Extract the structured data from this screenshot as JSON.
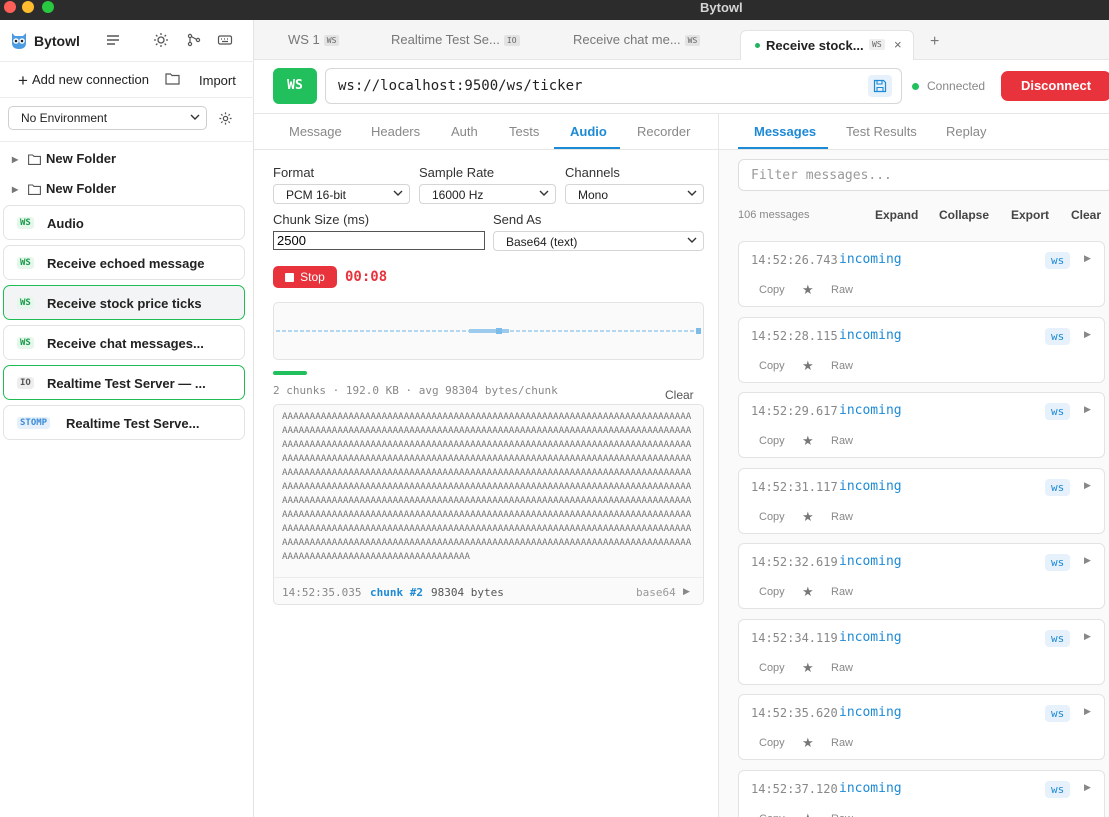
{
  "window": {
    "title": "Bytowl"
  },
  "sidebar": {
    "app_name": "Bytowl",
    "add_connection_label": "Add new connection",
    "import_label": "Import",
    "environment": "No Environment",
    "folders": [
      "New Folder",
      "New Folder"
    ],
    "connections": [
      {
        "badge": "WS",
        "label": "Audio"
      },
      {
        "badge": "WS",
        "label": "Receive echoed message"
      },
      {
        "badge": "WS",
        "label": "Receive stock price ticks"
      },
      {
        "badge": "WS",
        "label": "Receive chat messages..."
      },
      {
        "badge": "IO",
        "label": "Realtime Test Server — ..."
      },
      {
        "badge": "STOMP",
        "label": "Realtime Test Serve..."
      }
    ]
  },
  "tabs": [
    {
      "label": "WS 1",
      "badge": "WS"
    },
    {
      "label": "Realtime Test Se...",
      "badge": "IO"
    },
    {
      "label": "Receive chat me...",
      "badge": "WS"
    },
    {
      "label": "Receive stock...",
      "badge": "WS"
    }
  ],
  "url_bar": {
    "protocol": "WS",
    "url": "ws://localhost:9500/ws/ticker",
    "status": "Connected",
    "disconnect_label": "Disconnect",
    "status_color": "#22c05c"
  },
  "request_tabs": [
    "Message",
    "Headers",
    "Auth",
    "Tests",
    "Audio",
    "Recorder"
  ],
  "audio": {
    "format_label": "Format",
    "format_value": "PCM 16-bit",
    "sample_rate_label": "Sample Rate",
    "sample_rate_value": "16000 Hz",
    "channels_label": "Channels",
    "channels_value": "Mono",
    "chunk_size_label": "Chunk Size (ms)",
    "chunk_size_value": "2500",
    "send_as_label": "Send As",
    "send_as_value": "Base64 (text)",
    "stop_label": "Stop",
    "timer": "00:08",
    "level_fraction": 0.08,
    "stats": "2 chunks · 192.0 KB · avg 98304 bytes/chunk",
    "clear_label": "Clear",
    "payload": "AAAAAAAAAAAAAAAAAAAAAAAAAAAAAAAAAAAAAAAAAAAAAAAAAAAAAAAAAAAAAAAAAAAAAAAAAAAAAAAAAAAAAAAAAAAAAAAAAAAAAAAAAAAAAAAAAAAAAAAAAAAAAAAAAAAAAAAAAAAAAAAAAAAAAAAAAAAAAAAAAAAAAAAAAAAAAAAAAAAAAAAAAAAAAAAAAAAAAAAAAAAAAAAAAAAAAAAAAAAAAAAAAAAAAAAAAAAAAAAAAAAAAAAAAAAAAAAAAAAAAAAAAAAAAAAAAAAAAAAAAAAAAAAAAAAAAAAAAAAAAAAAAAAAAAAAAAAAAAAAAAAAAAAAAAAAAAAAAAAAAAAAAAAAAAAAAAAAAAAAAAAAAAAAAAAAAAAAAAAAAAAAAAAAAAAAAAAAAAAAAAAAAAAAAAAAAAAAAAAAAAAAAAAAAAAAAAAAAAAAAAAAAAAAAAAAAAAAAAAAAAAAAAAAAAAAAAAAAAAAAAAAAAAAAAAAAAAAAAAAAAAAAAAAAAAAAAAAAAAAAAAAAAAAAAAAAAAAAAAAAAAAAAAAAAAAAAAAAAAAAAAAAAAAAAAAAAAAAAAAAAAAAAAAAAAAAAAAAAAAAAAAAAAAAAAAAAAAAAAAAAAAAAAAAAAAAAAAAAAAAAAAAAAAAAAAAAAAAAAAAAAAAAAAAAAAAAAAAAAAAAAAAAAAAAAAAAAAAAAAAAAAAAAAAAAAAAAAAAAAAAAAAAAAAAAAAAAAAAAAAAAAAAAAAAAAAAAAAAAAAAAAAAAAAAAAAA",
    "last_chunk": {
      "timestamp": "14:52:35.035",
      "chunk": "chunk #2",
      "bytes": "98304 bytes",
      "encoding": "base64"
    }
  },
  "messages_tabs": [
    "Messages",
    "Test Results",
    "Replay"
  ],
  "messages": {
    "filter_placeholder": "Filter messages...",
    "count": "106 messages",
    "expand_label": "Expand",
    "collapse_label": "Collapse",
    "export_label": "Export",
    "clear_label": "Clear",
    "copy_label": "Copy",
    "raw_label": "Raw",
    "items": [
      {
        "ts": "14:52:26.743",
        "dir": "incoming",
        "badge": "ws"
      },
      {
        "ts": "14:52:28.115",
        "dir": "incoming",
        "badge": "ws"
      },
      {
        "ts": "14:52:29.617",
        "dir": "incoming",
        "badge": "ws"
      },
      {
        "ts": "14:52:31.117",
        "dir": "incoming",
        "badge": "ws"
      },
      {
        "ts": "14:52:32.619",
        "dir": "incoming",
        "badge": "ws"
      },
      {
        "ts": "14:52:34.119",
        "dir": "incoming",
        "badge": "ws"
      },
      {
        "ts": "14:52:35.620",
        "dir": "incoming",
        "badge": "ws"
      },
      {
        "ts": "14:52:37.120",
        "dir": "incoming",
        "badge": "ws"
      }
    ]
  }
}
